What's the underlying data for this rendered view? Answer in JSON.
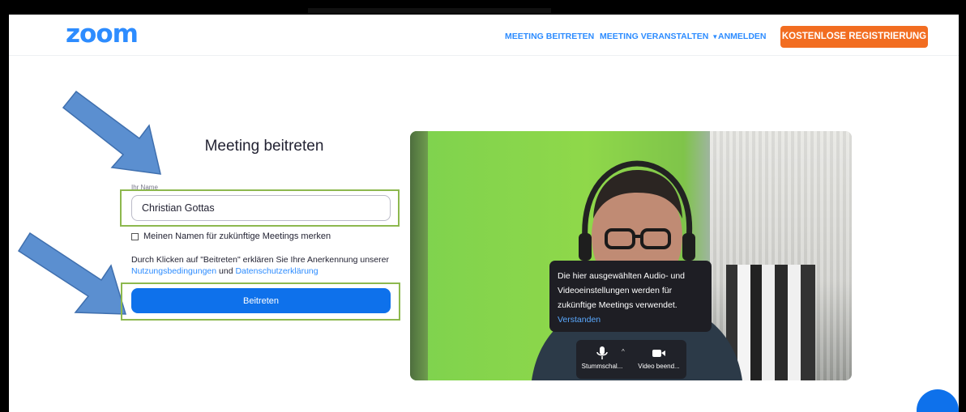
{
  "header": {
    "logo": "zoom",
    "nav_join": "MEETING BEITRETEN",
    "nav_host": "MEETING VERANSTALTEN",
    "nav_login": "ANMELDEN",
    "nav_register": "KOSTENLOSE REGISTRIERUNG"
  },
  "form": {
    "title": "Meeting beitreten",
    "name_label": "Ihr Name",
    "name_value": "Christian Gottas",
    "remember_label": "Meinen Namen für zukünftige Meetings merken",
    "terms_prefix": "Durch Klicken auf \"Beitreten\" erklären Sie Ihre Anerkennung unserer",
    "terms_link": "Nutzungsbedingungen",
    "terms_and": "und",
    "privacy_link": "Datenschutzerklärung",
    "join_button": "Beitreten"
  },
  "preview": {
    "tooltip_text": "Die hier ausgewählten Audio- und Videoeinstellungen werden für zukünftige Meetings verwendet.",
    "tooltip_link": "Verstanden",
    "mute_label": "Stummschal...",
    "video_label": "Video beend..."
  },
  "colors": {
    "brand_blue": "#2D8CFF",
    "join_button": "#0E71EB",
    "register_orange": "#F26D21",
    "highlight_green": "#8DB84E",
    "arrow_blue": "#5B8FD0"
  },
  "icons": [
    "arrow-annotation-icon",
    "microphone-icon",
    "video-camera-icon",
    "caret-down-icon",
    "chat-icon"
  ]
}
